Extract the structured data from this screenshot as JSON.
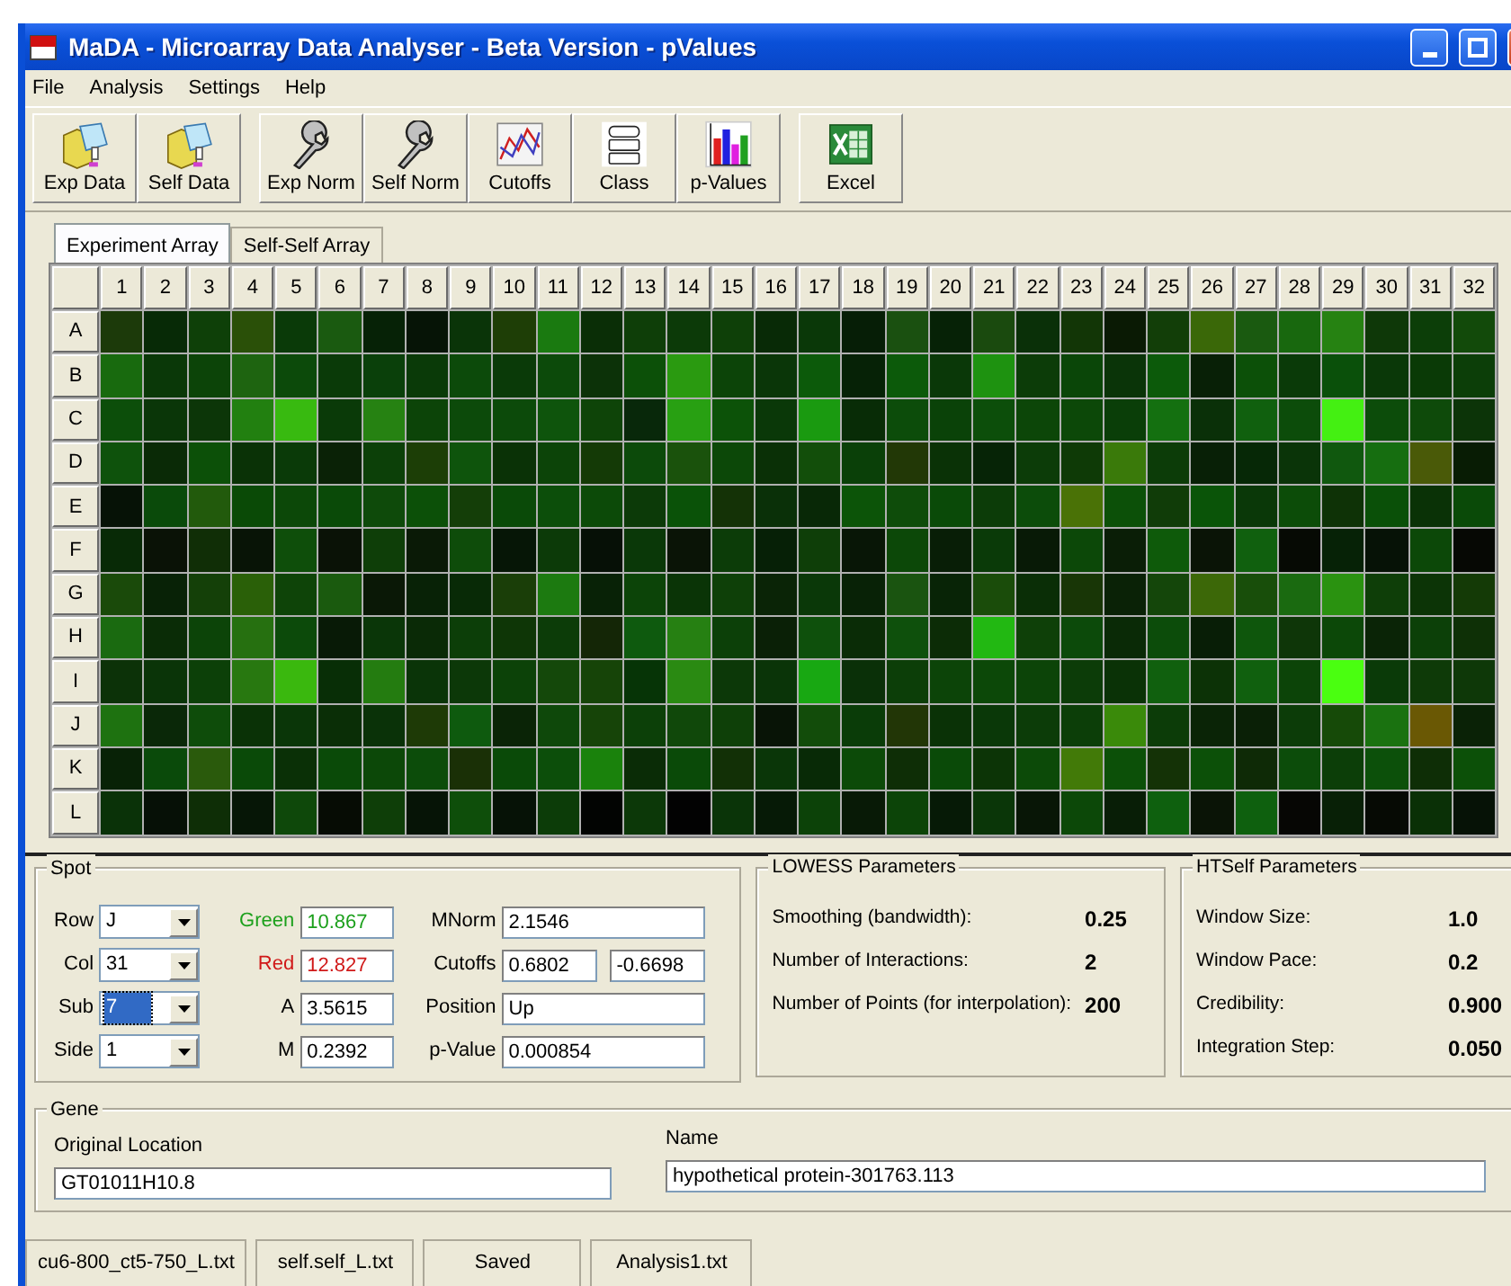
{
  "window": {
    "title": "MaDA - Microarray Data Analyser - Beta Version - pValues"
  },
  "menu": [
    "File",
    "Analysis",
    "Settings",
    "Help"
  ],
  "toolbar": [
    [
      {
        "label": "Exp Data",
        "kind": "folder"
      },
      {
        "label": "Self Data",
        "kind": "folder"
      }
    ],
    [
      {
        "label": "Exp Norm",
        "kind": "wrench"
      },
      {
        "label": "Self Norm",
        "kind": "wrench"
      },
      {
        "label": "Cutoffs",
        "kind": "plot"
      },
      {
        "label": "Class",
        "kind": "stack"
      },
      {
        "label": "p-Values",
        "kind": "bars"
      }
    ],
    [
      {
        "label": "Excel",
        "kind": "sheet"
      }
    ]
  ],
  "tabs": [
    {
      "label": "Experiment Array",
      "selected": true
    },
    {
      "label": "Self-Self Array",
      "selected": false
    }
  ],
  "grid": {
    "columns": [
      "1",
      "2",
      "3",
      "4",
      "5",
      "6",
      "7",
      "8",
      "9",
      "10",
      "11",
      "12",
      "13",
      "14",
      "15",
      "16",
      "17",
      "18",
      "19",
      "20",
      "21",
      "22",
      "23",
      "24",
      "25",
      "26",
      "27",
      "28",
      "29",
      "30",
      "31",
      "32"
    ],
    "rows": [
      {
        "label": "A",
        "cells": [
          {
            "color": "#1c3a0a"
          },
          {
            "color": "#072a06"
          },
          {
            "color": "#0e4008"
          },
          {
            "color": "#2a5008"
          },
          {
            "color": "#0a3a08"
          },
          {
            "color": "#1a5a10"
          },
          {
            "color": "#062206"
          },
          {
            "color": "#061406"
          },
          {
            "color": "#0a3408"
          },
          {
            "color": "#1e3e06"
          },
          {
            "color": "#1a7a10"
          },
          {
            "color": "#0a2e06"
          },
          {
            "color": "#0e3e08"
          },
          {
            "color": "#0c3a08"
          },
          {
            "color": "#0e4008"
          },
          {
            "color": "#082a06"
          },
          {
            "color": "#0a3808"
          },
          {
            "color": "#061e06"
          },
          {
            "color": "#1a5010"
          },
          {
            "color": "#062206"
          },
          {
            "color": "#1a4a0e"
          },
          {
            "color": "#0a3008"
          },
          {
            "color": "#123606"
          },
          {
            "color": "#0a1a04"
          },
          {
            "color": "#123e08"
          },
          {
            "color": "#3a6808"
          },
          {
            "color": "#1a5a10"
          },
          {
            "color": "#18680e"
          },
          {
            "color": "#268212"
          },
          {
            "color": "#0e3808"
          },
          {
            "color": "#0c3e08"
          },
          {
            "color": "#124a0a"
          }
        ]
      },
      {
        "label": "B",
        "cells": [
          {
            "color": "#186a0e"
          },
          {
            "color": "#0a3808"
          },
          {
            "color": "#0c4408"
          },
          {
            "color": "#1e6410"
          },
          {
            "color": "#0c4a0a"
          },
          {
            "color": "#0a3a08"
          },
          {
            "color": "#0a400a"
          },
          {
            "color": "#0a3a08"
          },
          {
            "color": "#0c4a0a"
          },
          {
            "color": "#0a3a08"
          },
          {
            "color": "#0c4a0a"
          },
          {
            "color": "#0c3208"
          },
          {
            "color": "#0c5008"
          },
          {
            "color": "#2a9a10"
          },
          {
            "color": "#0c4408"
          },
          {
            "color": "#0a3608"
          },
          {
            "color": "#0c5a0a"
          },
          {
            "color": "#062206"
          },
          {
            "color": "#0c5a0a"
          },
          {
            "color": "#0a3808"
          },
          {
            "color": "#1e9210"
          },
          {
            "color": "#0c3c08"
          },
          {
            "color": "#0a4608"
          },
          {
            "color": "#0a3408"
          },
          {
            "color": "#0c5a0a"
          },
          {
            "color": "#082006"
          },
          {
            "color": "#0c5008"
          },
          {
            "color": "#0a3a08"
          },
          {
            "color": "#0a500a"
          },
          {
            "color": "#0a3808"
          },
          {
            "color": "#0a3a06"
          },
          {
            "color": "#0c3e08"
          }
        ]
      },
      {
        "label": "C",
        "cells": [
          {
            "color": "#0c4e0a"
          },
          {
            "color": "#0a3608"
          },
          {
            "color": "#0c3608"
          },
          {
            "color": "#228010"
          },
          {
            "color": "#38ba10"
          },
          {
            "color": "#0a3a08"
          },
          {
            "color": "#268212"
          },
          {
            "color": "#0c4408"
          },
          {
            "color": "#0c4a0a"
          },
          {
            "color": "#0c4a0a"
          },
          {
            "color": "#0e540c"
          },
          {
            "color": "#0e4408"
          },
          {
            "color": "#08280a"
          },
          {
            "color": "#28a012"
          },
          {
            "color": "#0c5208"
          },
          {
            "color": "#0a3808"
          },
          {
            "color": "#1a9a10"
          },
          {
            "color": "#082c06"
          },
          {
            "color": "#0c4c0a"
          },
          {
            "color": "#0a4208"
          },
          {
            "color": "#0c4e0a"
          },
          {
            "color": "#0c4608"
          },
          {
            "color": "#0c4808"
          },
          {
            "color": "#0a3e08"
          },
          {
            "color": "#147010"
          },
          {
            "color": "#0a3008"
          },
          {
            "color": "#10600e"
          },
          {
            "color": "#0c4c0a"
          },
          {
            "color": "#44f012"
          },
          {
            "color": "#0c4c0a"
          },
          {
            "color": "#0e4a0a"
          },
          {
            "color": "#0c3408"
          }
        ]
      },
      {
        "label": "D",
        "cells": [
          {
            "color": "#0e520c"
          },
          {
            "color": "#0a2a06"
          },
          {
            "color": "#0c5008"
          },
          {
            "color": "#0a3206"
          },
          {
            "color": "#0a3a08"
          },
          {
            "color": "#0a2206"
          },
          {
            "color": "#0c4008"
          },
          {
            "color": "#1c3e06"
          },
          {
            "color": "#0e540c"
          },
          {
            "color": "#0a3206"
          },
          {
            "color": "#0c4408"
          },
          {
            "color": "#143a06"
          },
          {
            "color": "#0c4a0a"
          },
          {
            "color": "#1a520c"
          },
          {
            "color": "#0c4808"
          },
          {
            "color": "#0a3006"
          },
          {
            "color": "#124e0a"
          },
          {
            "color": "#0a4008"
          },
          {
            "color": "#223806"
          },
          {
            "color": "#0a3206"
          },
          {
            "color": "#062406"
          },
          {
            "color": "#0c3c08"
          },
          {
            "color": "#0e3a06"
          },
          {
            "color": "#3a7a0a"
          },
          {
            "color": "#0c3c08"
          },
          {
            "color": "#082006"
          },
          {
            "color": "#062806"
          },
          {
            "color": "#0a3408"
          },
          {
            "color": "#10580e"
          },
          {
            "color": "#166e10"
          },
          {
            "color": "#4a5a08"
          },
          {
            "color": "#081c04"
          }
        ]
      },
      {
        "label": "E",
        "cells": [
          {
            "color": "#061206"
          },
          {
            "color": "#0a4a0a"
          },
          {
            "color": "#225a0c"
          },
          {
            "color": "#0a4a06"
          },
          {
            "color": "#0c4808"
          },
          {
            "color": "#0a4a08"
          },
          {
            "color": "#0e4a0a"
          },
          {
            "color": "#0c5008"
          },
          {
            "color": "#143e08"
          },
          {
            "color": "#0a4a08"
          },
          {
            "color": "#0c4e0a"
          },
          {
            "color": "#0c4a08"
          },
          {
            "color": "#0c3a08"
          },
          {
            "color": "#0a5208"
          },
          {
            "color": "#143206"
          },
          {
            "color": "#0a3008"
          },
          {
            "color": "#082806"
          },
          {
            "color": "#0c5408"
          },
          {
            "color": "#0e4c0a"
          },
          {
            "color": "#0a4a08"
          },
          {
            "color": "#0c3c08"
          },
          {
            "color": "#0c4c0a"
          },
          {
            "color": "#4a7206"
          },
          {
            "color": "#0c5008"
          },
          {
            "color": "#103c08"
          },
          {
            "color": "#0a5408"
          },
          {
            "color": "#0a3808"
          },
          {
            "color": "#0c4c08"
          },
          {
            "color": "#0e3206"
          },
          {
            "color": "#0a5008"
          },
          {
            "color": "#0a3206"
          },
          {
            "color": "#0a4a08"
          }
        ]
      },
      {
        "label": "F",
        "cells": [
          {
            "color": "#082a06"
          },
          {
            "color": "#0a1206"
          },
          {
            "color": "#102e06"
          },
          {
            "color": "#081406"
          },
          {
            "color": "#0e4e0a"
          },
          {
            "color": "#0a1206"
          },
          {
            "color": "#0e3e08"
          },
          {
            "color": "#0a1a06"
          },
          {
            "color": "#0e4c0a"
          },
          {
            "color": "#061606"
          },
          {
            "color": "#0c3a08"
          },
          {
            "color": "#061006"
          },
          {
            "color": "#0a3808"
          },
          {
            "color": "#0a1406"
          },
          {
            "color": "#0c3c08"
          },
          {
            "color": "#062006"
          },
          {
            "color": "#0e3e08"
          },
          {
            "color": "#081606"
          },
          {
            "color": "#0c4808"
          },
          {
            "color": "#081e06"
          },
          {
            "color": "#0a3a08"
          },
          {
            "color": "#081a06"
          },
          {
            "color": "#0c4808"
          },
          {
            "color": "#0a1e06"
          },
          {
            "color": "#0e5a0a"
          },
          {
            "color": "#0a1406"
          },
          {
            "color": "#10600e"
          },
          {
            "color": "#060a04"
          },
          {
            "color": "#062206"
          },
          {
            "color": "#061206"
          },
          {
            "color": "#0c4808"
          },
          {
            "color": "#060804"
          }
        ]
      },
      {
        "label": "G",
        "cells": [
          {
            "color": "#1a4a0a"
          },
          {
            "color": "#082206"
          },
          {
            "color": "#144008"
          },
          {
            "color": "#2a6008"
          },
          {
            "color": "#0e4408"
          },
          {
            "color": "#1a5a0e"
          },
          {
            "color": "#0a1806"
          },
          {
            "color": "#082206"
          },
          {
            "color": "#082a06"
          },
          {
            "color": "#1a3e08"
          },
          {
            "color": "#1c7a10"
          },
          {
            "color": "#082206"
          },
          {
            "color": "#0c4408"
          },
          {
            "color": "#0a3406"
          },
          {
            "color": "#0e4008"
          },
          {
            "color": "#0a2406"
          },
          {
            "color": "#0a3808"
          },
          {
            "color": "#082206"
          },
          {
            "color": "#1a5410"
          },
          {
            "color": "#082406"
          },
          {
            "color": "#1a4c0a"
          },
          {
            "color": "#0a2e06"
          },
          {
            "color": "#183606"
          },
          {
            "color": "#0a2206"
          },
          {
            "color": "#14460a"
          },
          {
            "color": "#3c6808"
          },
          {
            "color": "#184e0a"
          },
          {
            "color": "#1a6a10"
          },
          {
            "color": "#2a9210"
          },
          {
            "color": "#0e3e08"
          },
          {
            "color": "#0c3406"
          },
          {
            "color": "#143a06"
          }
        ]
      },
      {
        "label": "H",
        "cells": [
          {
            "color": "#1a6a10"
          },
          {
            "color": "#0a2c06"
          },
          {
            "color": "#0c4408"
          },
          {
            "color": "#267010"
          },
          {
            "color": "#0c4a0a"
          },
          {
            "color": "#081a06"
          },
          {
            "color": "#0a3608"
          },
          {
            "color": "#0a2a06"
          },
          {
            "color": "#0c3e08"
          },
          {
            "color": "#0e3606"
          },
          {
            "color": "#0c3c08"
          },
          {
            "color": "#142606"
          },
          {
            "color": "#0e5a0e"
          },
          {
            "color": "#268012"
          },
          {
            "color": "#0c4008"
          },
          {
            "color": "#0a2006"
          },
          {
            "color": "#0e500c"
          },
          {
            "color": "#0a2c06"
          },
          {
            "color": "#0e500c"
          },
          {
            "color": "#0c2c06"
          },
          {
            "color": "#22b812"
          },
          {
            "color": "#0e4008"
          },
          {
            "color": "#0c4a0a"
          },
          {
            "color": "#0a2a06"
          },
          {
            "color": "#0c4c0a"
          },
          {
            "color": "#081e06"
          },
          {
            "color": "#0e560c"
          },
          {
            "color": "#0e3608"
          },
          {
            "color": "#0c4808"
          },
          {
            "color": "#0a2406"
          },
          {
            "color": "#0c4008"
          },
          {
            "color": "#0e3006"
          }
        ]
      },
      {
        "label": "I",
        "cells": [
          {
            "color": "#0c3208"
          },
          {
            "color": "#0a3408"
          },
          {
            "color": "#0c4008"
          },
          {
            "color": "#287810"
          },
          {
            "color": "#3ab80e"
          },
          {
            "color": "#082e06"
          },
          {
            "color": "#247c10"
          },
          {
            "color": "#0a3408"
          },
          {
            "color": "#0c3808"
          },
          {
            "color": "#0c4208"
          },
          {
            "color": "#14480a"
          },
          {
            "color": "#164408"
          },
          {
            "color": "#063406"
          },
          {
            "color": "#2a8a12"
          },
          {
            "color": "#0c3808"
          },
          {
            "color": "#0a3408"
          },
          {
            "color": "#18a812"
          },
          {
            "color": "#0a3008"
          },
          {
            "color": "#0c3e08"
          },
          {
            "color": "#0c4408"
          },
          {
            "color": "#0c4808"
          },
          {
            "color": "#0c4408"
          },
          {
            "color": "#0c3c08"
          },
          {
            "color": "#0a3206"
          },
          {
            "color": "#10600e"
          },
          {
            "color": "#0c3206"
          },
          {
            "color": "#10600e"
          },
          {
            "color": "#0c4408"
          },
          {
            "color": "#4aff10"
          },
          {
            "color": "#0a3a08"
          },
          {
            "color": "#0e3a08"
          },
          {
            "color": "#0e3808"
          }
        ]
      },
      {
        "label": "J",
        "cells": [
          {
            "color": "#1e7210"
          },
          {
            "color": "#0a2808"
          },
          {
            "color": "#0e4c0a"
          },
          {
            "color": "#0a3206"
          },
          {
            "color": "#0a3608"
          },
          {
            "color": "#0a2e06"
          },
          {
            "color": "#0a3208"
          },
          {
            "color": "#1e3a06"
          },
          {
            "color": "#0e5a0e"
          },
          {
            "color": "#0a2406"
          },
          {
            "color": "#0e480a"
          },
          {
            "color": "#164408"
          },
          {
            "color": "#0c4008"
          },
          {
            "color": "#10480a"
          },
          {
            "color": "#0e4008"
          },
          {
            "color": "#081406"
          },
          {
            "color": "#124c0a"
          },
          {
            "color": "#0a3c08"
          },
          {
            "color": "#223606"
          },
          {
            "color": "#0a3206"
          },
          {
            "color": "#0a3808"
          },
          {
            "color": "#0c3c08"
          },
          {
            "color": "#0c3e08"
          },
          {
            "color": "#3a8a0a"
          },
          {
            "color": "#0c3c08"
          },
          {
            "color": "#0a2406"
          },
          {
            "color": "#0a2006"
          },
          {
            "color": "#0c3c08"
          },
          {
            "color": "#164a08"
          },
          {
            "color": "#1a7210"
          },
          {
            "color": "#6a5804"
          },
          {
            "color": "#0a2206"
          }
        ]
      },
      {
        "label": "K",
        "cells": [
          {
            "color": "#082206"
          },
          {
            "color": "#0a4a0a"
          },
          {
            "color": "#2a5a0c"
          },
          {
            "color": "#0a4a08"
          },
          {
            "color": "#0a3006"
          },
          {
            "color": "#0a4a08"
          },
          {
            "color": "#0c4808"
          },
          {
            "color": "#0c4c0a"
          },
          {
            "color": "#1a3006"
          },
          {
            "color": "#0a4a08"
          },
          {
            "color": "#0c4e0a"
          },
          {
            "color": "#1a820c"
          },
          {
            "color": "#0a2c06"
          },
          {
            "color": "#0a4a08"
          },
          {
            "color": "#123006"
          },
          {
            "color": "#0a3608"
          },
          {
            "color": "#082a06"
          },
          {
            "color": "#0c4a08"
          },
          {
            "color": "#0e2e06"
          },
          {
            "color": "#0a4a08"
          },
          {
            "color": "#0c3406"
          },
          {
            "color": "#0c4a08"
          },
          {
            "color": "#427a08"
          },
          {
            "color": "#0c5008"
          },
          {
            "color": "#143206"
          },
          {
            "color": "#0c5008"
          },
          {
            "color": "#0e2a06"
          },
          {
            "color": "#0c4c0a"
          },
          {
            "color": "#0c3e08"
          },
          {
            "color": "#0c500a"
          },
          {
            "color": "#0e2e06"
          },
          {
            "color": "#0c5008"
          }
        ]
      },
      {
        "label": "L",
        "cells": [
          {
            "color": "#0a3208"
          },
          {
            "color": "#061006"
          },
          {
            "color": "#0e2e06"
          },
          {
            "color": "#061606"
          },
          {
            "color": "#0e480a"
          },
          {
            "color": "#060c04"
          },
          {
            "color": "#0e3e08"
          },
          {
            "color": "#061406"
          },
          {
            "color": "#0e4e0a"
          },
          {
            "color": "#061206"
          },
          {
            "color": "#0c3c08"
          },
          {
            "color": "#020402"
          },
          {
            "color": "#0c3808"
          },
          {
            "color": "#020202"
          },
          {
            "color": "#0a3408"
          },
          {
            "color": "#061a06"
          },
          {
            "color": "#0c4208"
          },
          {
            "color": "#081a06"
          },
          {
            "color": "#0c4408"
          },
          {
            "color": "#061a06"
          },
          {
            "color": "#0a3608"
          },
          {
            "color": "#081606"
          },
          {
            "color": "#0c4808"
          },
          {
            "color": "#081e06"
          },
          {
            "color": "#0e600e"
          },
          {
            "color": "#0a1406"
          },
          {
            "color": "#0e600e"
          },
          {
            "color": "#060604"
          },
          {
            "color": "#082006"
          },
          {
            "color": "#060a04"
          },
          {
            "color": "#0a3006"
          },
          {
            "color": "#061206"
          }
        ]
      }
    ]
  },
  "spot": {
    "title": "Spot",
    "selectors": [
      {
        "label": "Row",
        "value": "J",
        "focused": false
      },
      {
        "label": "Col",
        "value": "31",
        "focused": false
      },
      {
        "label": "Sub",
        "value": "7",
        "focused": true
      },
      {
        "label": "Side",
        "value": "1",
        "focused": false
      }
    ],
    "intensities": [
      {
        "label": "Green",
        "value": "10.867",
        "kind": "green"
      },
      {
        "label": "Red",
        "value": "12.827",
        "kind": "red"
      },
      {
        "label": "A",
        "value": "3.5615",
        "kind": "plain"
      },
      {
        "label": "M",
        "value": "0.2392",
        "kind": "plain"
      }
    ],
    "results": [
      {
        "label": "MNorm",
        "values": [
          "2.1546"
        ]
      },
      {
        "label": "Cutoffs",
        "values": [
          "0.6802",
          "-0.6698"
        ]
      },
      {
        "label": "Position",
        "values": [
          "Up"
        ]
      },
      {
        "label": "p-Value",
        "values": [
          "0.000854"
        ]
      }
    ]
  },
  "lowess": {
    "title": "LOWESS Parameters",
    "params": [
      {
        "label": "Smoothing (bandwidth):",
        "value": "0.25"
      },
      {
        "label": "Number of Interactions:",
        "value": "2"
      },
      {
        "label": "Number of Points (for interpolation):",
        "value": "200"
      }
    ]
  },
  "htself": {
    "title": "HTSelf Parameters",
    "params": [
      {
        "label": "Window Size:",
        "value": "1.0"
      },
      {
        "label": "Window Pace:",
        "value": "0.2"
      },
      {
        "label": "Credibility:",
        "value": "0.900"
      },
      {
        "label": "Integration Step:",
        "value": "0.050"
      }
    ]
  },
  "gene": {
    "title": "Gene",
    "fields": [
      {
        "label": "Original Location",
        "value": "GT01011H10.8"
      },
      {
        "label": "Name",
        "value": "hypothetical protein-301763.113"
      }
    ]
  },
  "status_bar": [
    "cu6-800_ct5-750_L.txt",
    "self.self_L.txt",
    "Saved",
    "Analysis1.txt"
  ]
}
